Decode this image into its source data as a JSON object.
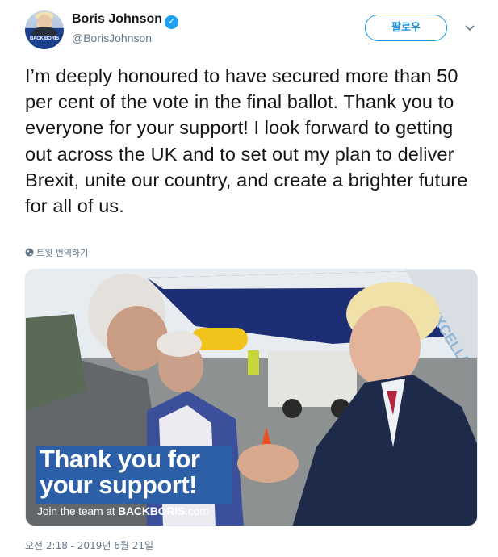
{
  "author": {
    "display_name": "Boris Johnson",
    "handle": "@BorisJohnson",
    "avatar_text": "BACK BORIS",
    "verified_icon": "verified-badge-icon"
  },
  "actions": {
    "follow_label": "팔로우",
    "menu_icon": "chevron-down-icon"
  },
  "tweet": {
    "text": "I’m deeply honoured to have secured more than 50 per cent of the vote in the final ballot. Thank you to everyone for your support! I look forward to getting out across the UK and to set out my plan to deliver Brexit, unite our country, and create a brighter future for all of us.",
    "translate_label": "트윗 번역하기",
    "translate_icon": "globe-icon",
    "timestamp": "오전 2:18 - 2019년 6월 21일"
  },
  "media": {
    "banner_line1": "Thank you for",
    "banner_line2": "your support!",
    "join_prefix": "Join the team at ",
    "join_site_bold": "BACKBORIS",
    "join_site_suffix": ".com",
    "plane_text": "EXCELLE"
  },
  "colors": {
    "link_blue": "#1b95e0",
    "verified_blue": "#1da1f2",
    "banner_blue": "#2d5fa7",
    "text_primary": "#14171a",
    "text_secondary": "#657786"
  }
}
